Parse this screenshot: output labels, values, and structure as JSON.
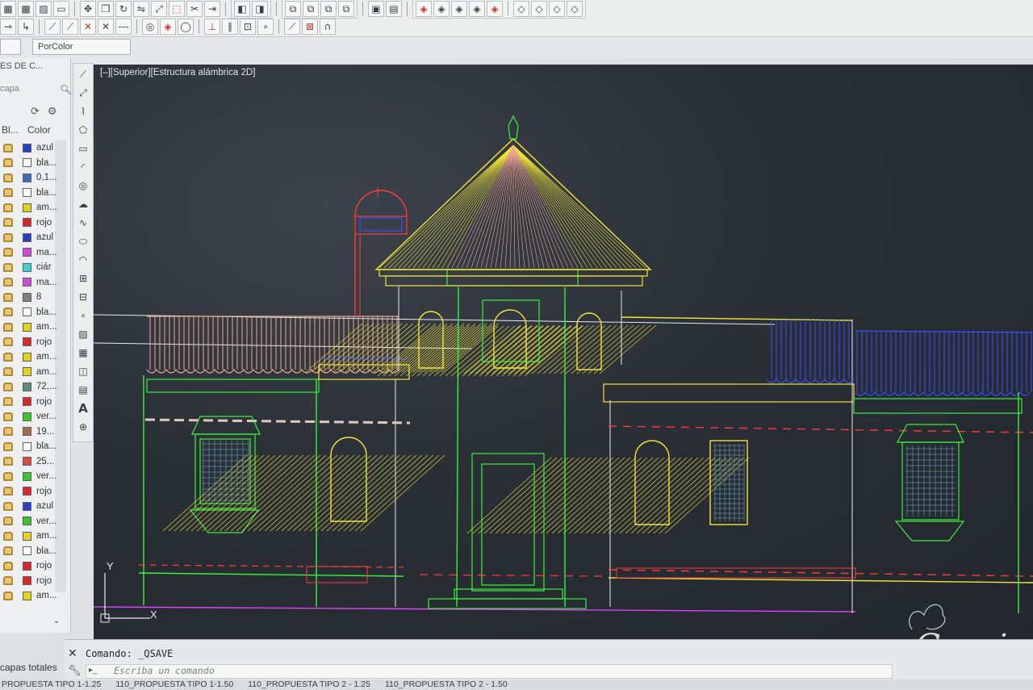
{
  "ribbon": {
    "row1_icons": [
      "layer-icon",
      "grid-icon",
      "hatch-icon",
      "rect-icon",
      "move-icon",
      "copy-icon",
      "rotate-icon",
      "mirror-icon",
      "scale-icon",
      "stretch-icon",
      "trim-icon",
      "extend-icon",
      "break-icon",
      "join-icon",
      "chamfer-icon",
      "fillet-icon",
      "explode-icon",
      "array-icon"
    ],
    "row2_icons": [
      "snap-icon",
      "line-snap-icon",
      "polar-icon",
      "trim-icon",
      "trim2-icon",
      "ellipse-arc-icon",
      "center-icon",
      "circle-snap-icon",
      "tangent-icon",
      "perp-icon",
      "parallel-icon",
      "measure-icon",
      "node-icon",
      "dim-icon",
      "magnet-icon"
    ]
  },
  "properties": {
    "color_dropdown": "PorColor"
  },
  "layer_panel": {
    "title": "ES DE C...",
    "search_placeholder": "capa",
    "col_block": "Bl...",
    "col_color": "Color",
    "layers": [
      {
        "color_name": "azul",
        "swatch": "#2a3fc4"
      },
      {
        "color_name": "bla...",
        "swatch": "#ffffff"
      },
      {
        "color_name": "0,1...",
        "swatch": "#3b6fb2"
      },
      {
        "color_name": "bla...",
        "swatch": "#ffffff"
      },
      {
        "color_name": "am...",
        "swatch": "#e6d21c"
      },
      {
        "color_name": "rojo",
        "swatch": "#d8282a"
      },
      {
        "color_name": "azul",
        "swatch": "#2a3fc4"
      },
      {
        "color_name": "ma...",
        "swatch": "#d04ad8"
      },
      {
        "color_name": "ciár",
        "swatch": "#3fd0d0"
      },
      {
        "color_name": "ma...",
        "swatch": "#d04ad8"
      },
      {
        "color_name": "8",
        "swatch": "#808080"
      },
      {
        "color_name": "bla...",
        "swatch": "#ffffff"
      },
      {
        "color_name": "am...",
        "swatch": "#e6d21c"
      },
      {
        "color_name": "rojo",
        "swatch": "#d8282a"
      },
      {
        "color_name": "am...",
        "swatch": "#e6d21c"
      },
      {
        "color_name": "am...",
        "swatch": "#e6d21c"
      },
      {
        "color_name": "72,...",
        "swatch": "#5e8a7a"
      },
      {
        "color_name": "rojo",
        "swatch": "#d8282a"
      },
      {
        "color_name": "ver...",
        "swatch": "#3ec42c"
      },
      {
        "color_name": "19...",
        "swatch": "#a0704a"
      },
      {
        "color_name": "bla...",
        "swatch": "#ffffff"
      },
      {
        "color_name": "25...",
        "swatch": "#d84a40"
      },
      {
        "color_name": "ver...",
        "swatch": "#3ec42c"
      },
      {
        "color_name": "rojo",
        "swatch": "#d8282a"
      },
      {
        "color_name": "azul",
        "swatch": "#2a3fc4"
      },
      {
        "color_name": "ver...",
        "swatch": "#3ec42c"
      },
      {
        "color_name": "am...",
        "swatch": "#e6d21c"
      },
      {
        "color_name": "bla...",
        "swatch": "#ffffff"
      },
      {
        "color_name": "rojo",
        "swatch": "#d8282a"
      },
      {
        "color_name": "rojo",
        "swatch": "#d8282a"
      },
      {
        "color_name": "am...",
        "swatch": "#e6d21c"
      }
    ],
    "total_label": "capas totales"
  },
  "draw_toolbar": [
    "line-icon",
    "construction-line-icon",
    "polyline-icon",
    "polygon-icon",
    "rectangle-icon",
    "arc-icon",
    "circle-icon",
    "revcloud-icon",
    "spline-icon",
    "ellipse-icon",
    "ellipse-arc-icon",
    "insert-block-icon",
    "make-block-icon",
    "point-icon",
    "hatch-icon",
    "gradient-icon",
    "region-icon",
    "table-icon",
    "text-icon",
    "add-selected-icon"
  ],
  "viewport": {
    "label": "[–][Superior][Estructura alámbrica 2D]",
    "colors": {
      "bg": "#282d34",
      "green": "#3cf03c",
      "yellow": "#f2e43a",
      "red": "#ff3b3b",
      "salmon": "#f0a890",
      "blue": "#3a50ff",
      "white": "#e8ecef",
      "magenta": "#e040ff"
    },
    "ucs_x": "X",
    "ucs_y": "Y"
  },
  "command": {
    "history": "Comando:  _QSAVE",
    "placeholder": "Escriba un comando"
  },
  "layout_tabs": [
    "PROPUESTA TIPO 1-1.25",
    "110_PROPUESTA TIPO 1-1.50",
    "110_PROPUESTA TIPO 2 - 1.25",
    "110_PROPUESTA TIPO 2 - 1.50"
  ],
  "watermark": "Garvi"
}
